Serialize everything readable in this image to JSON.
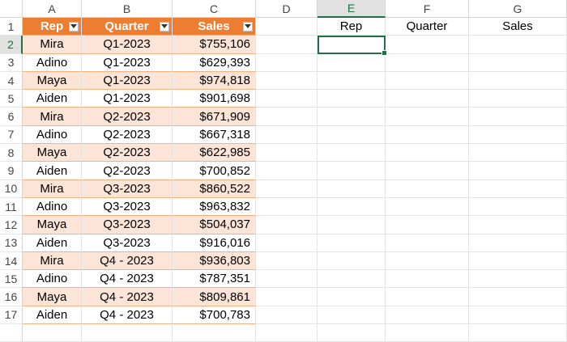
{
  "columns": [
    "A",
    "B",
    "C",
    "D",
    "E",
    "F",
    "G"
  ],
  "active_column": "E",
  "row_numbers": [
    "1",
    "2",
    "3",
    "4",
    "5",
    "6",
    "7",
    "8",
    "9",
    "10",
    "11",
    "12",
    "13",
    "14",
    "15",
    "16",
    "17",
    ""
  ],
  "active_row": "2",
  "table": {
    "headers": [
      "Rep",
      "Quarter",
      "Sales"
    ],
    "rows": [
      [
        "Mira",
        "Q1-2023",
        "$755,106"
      ],
      [
        "Adino",
        "Q1-2023",
        "$629,393"
      ],
      [
        "Maya",
        "Q1-2023",
        "$974,818"
      ],
      [
        "Aiden",
        "Q1-2023",
        "$901,698"
      ],
      [
        "Mira",
        "Q2-2023",
        "$671,909"
      ],
      [
        "Adino",
        "Q2-2023",
        "$667,318"
      ],
      [
        "Maya",
        "Q2-2023",
        "$622,985"
      ],
      [
        "Aiden",
        "Q2-2023",
        "$700,852"
      ],
      [
        "Mira",
        "Q3-2023",
        "$860,522"
      ],
      [
        "Adino",
        "Q3-2023",
        "$963,832"
      ],
      [
        "Maya",
        "Q3-2023",
        "$504,037"
      ],
      [
        "Aiden",
        "Q3-2023",
        "$916,016"
      ],
      [
        "Mira",
        "Q4 - 2023",
        "$936,803"
      ],
      [
        "Adino",
        "Q4 - 2023",
        "$787,351"
      ],
      [
        "Maya",
        "Q4 - 2023",
        "$809,861"
      ],
      [
        "Aiden",
        "Q4 - 2023",
        "$700,783"
      ]
    ]
  },
  "side_headers": [
    "Rep",
    "Quarter",
    "Sales"
  ],
  "colors": {
    "table_header": "#ed7d31",
    "band": "#fce4d6",
    "selection": "#1e7145"
  },
  "icons": {
    "filter": "filter-dropdown-icon"
  }
}
